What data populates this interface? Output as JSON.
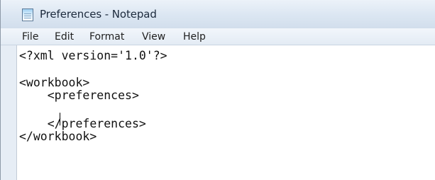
{
  "window": {
    "title": "Preferences - Notepad",
    "app_icon": "notepad-icon"
  },
  "menubar": {
    "items": [
      "File",
      "Edit",
      "Format",
      "View",
      "Help"
    ]
  },
  "editor": {
    "lines": [
      "<?xml version='1.0'?>",
      "",
      "<workbook>",
      "    <preferences>",
      "",
      "    </preferences>",
      "</workbook>"
    ]
  }
}
